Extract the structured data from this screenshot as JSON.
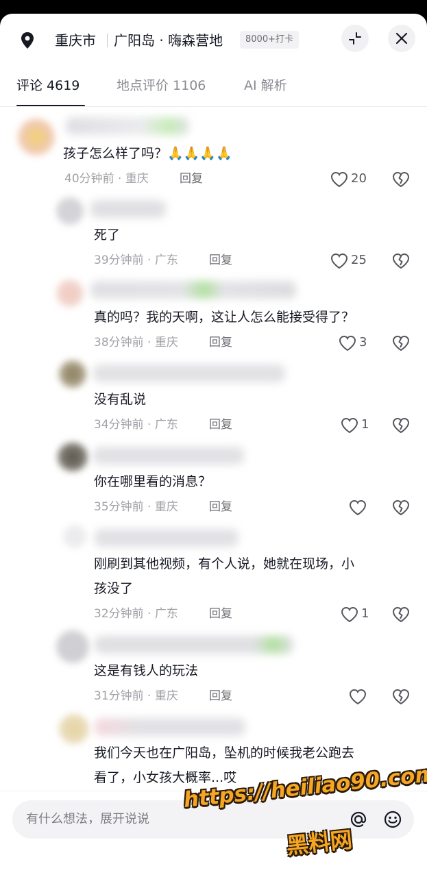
{
  "header": {
    "city": "重庆市",
    "place": "广阳岛 · 嗨森营地",
    "checkins": "8000+打卡",
    "icons": {
      "location": "location-pin-icon",
      "minimize": "minimize-icon",
      "close": "close-icon"
    }
  },
  "tabs": [
    {
      "label": "评论 4619",
      "active": true
    },
    {
      "label": "地点评价 1106",
      "active": false
    },
    {
      "label": "AI 解析",
      "active": false
    }
  ],
  "comments": [
    {
      "text": "孩子怎么样了吗？🙏🙏🙏🙏",
      "meta": "40分钟前 · 重庆",
      "reply": "回复",
      "likes": "20"
    },
    {
      "text": "死了",
      "meta": "39分钟前 · 广东",
      "reply": "回复",
      "likes": "25"
    },
    {
      "text": "真的吗？我的天啊，这让人怎么能接受得了？",
      "meta": "38分钟前 · 重庆",
      "reply": "回复",
      "likes": "3"
    },
    {
      "text": "没有乱说",
      "meta": "34分钟前 · 广东",
      "reply": "回复",
      "likes": "1"
    },
    {
      "text": "你在哪里看的消息？",
      "meta": "35分钟前 · 重庆",
      "reply": "回复",
      "likes": ""
    },
    {
      "text_line1": "刚刷到其他视频，有个人说，她就在现场，小",
      "text_line2": "孩没了",
      "meta": "32分钟前 · 广东",
      "reply": "回复",
      "likes": "1"
    },
    {
      "text": "这是有钱人的玩法",
      "meta": "31分钟前 · 重庆",
      "reply": "回复",
      "likes": ""
    },
    {
      "text_line1": "我们今天也在广阳岛，坠机的时候我老公跑去",
      "text_line2": "看了，小女孩大概率...哎"
    }
  ],
  "input": {
    "placeholder": "有什么想法，展开说说",
    "icons": {
      "mention": "at-icon",
      "emoji": "emoji-icon"
    }
  },
  "watermark": {
    "url": "https://heiliao90.com",
    "name": "黑料网"
  },
  "colors": {
    "text_primary": "#161823",
    "text_secondary": "#a1a2a7",
    "watermark": "#f5a623"
  }
}
